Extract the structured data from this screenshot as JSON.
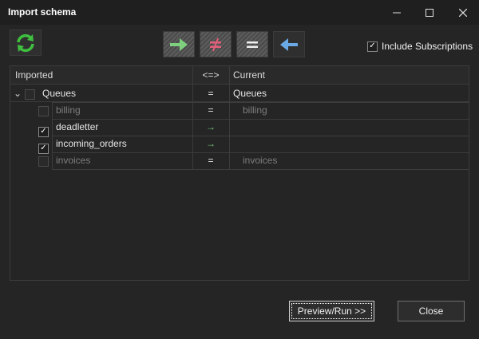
{
  "window": {
    "title": "Import schema",
    "controls": [
      "minimize-icon",
      "maximize-icon",
      "close-icon"
    ]
  },
  "toolbar": {
    "refresh_icon": "refresh-icon",
    "buttons": [
      {
        "name": "import-arrow-right",
        "icon": "arrow-right-icon"
      },
      {
        "name": "not-equal",
        "icon": "not-equal-icon"
      },
      {
        "name": "equal",
        "icon": "equal-icon"
      },
      {
        "name": "export-arrow-left",
        "icon": "arrow-left-icon"
      }
    ],
    "include_subscriptions_label": "Include Subscriptions",
    "include_subscriptions_checked": true
  },
  "grid": {
    "headers": {
      "imported": "Imported",
      "compare": "<=>",
      "current": "Current"
    },
    "rows": [
      {
        "imported": "Queues",
        "compare": "=",
        "current": "Queues",
        "checked": false,
        "level": 0,
        "dim": false,
        "expanded": true
      },
      {
        "imported": "billing",
        "compare": "=",
        "current": "billing",
        "checked": false,
        "level": 1,
        "dim": true
      },
      {
        "imported": "deadletter",
        "compare": "→",
        "current": "",
        "checked": true,
        "level": 1,
        "dim": false
      },
      {
        "imported": "incoming_orders",
        "compare": "→",
        "current": "",
        "checked": true,
        "level": 1,
        "dim": false
      },
      {
        "imported": "invoices",
        "compare": "=",
        "current": "invoices",
        "checked": false,
        "level": 1,
        "dim": true
      }
    ]
  },
  "footer": {
    "preview_label": "Preview/Run >>",
    "close_label": "Close"
  },
  "colors": {
    "arrow_right": "#7ed07e",
    "not_equal": "#e2607a",
    "arrow_left": "#6aa8e6",
    "refresh": "#3fbf3f"
  }
}
